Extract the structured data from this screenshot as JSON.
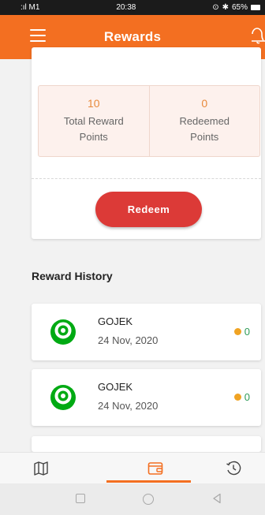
{
  "status_bar": {
    "carrier": ":ıl M1",
    "time": "20:38",
    "battery": "65%"
  },
  "app_bar": {
    "title": "Rewards",
    "menu_icon": "hamburger-menu-icon",
    "bell_icon": "bell-icon"
  },
  "summary": {
    "total": {
      "value": "10",
      "label": "Total Reward Points"
    },
    "redeemed": {
      "value": "0",
      "label": "Redeemed Points"
    },
    "redeem_button_label": "Redeem"
  },
  "history": {
    "title": "Reward History",
    "items": [
      {
        "merchant": "GOJEK",
        "date": "24 Nov, 2020",
        "points": "0"
      },
      {
        "merchant": "GOJEK",
        "date": "24 Nov, 2020",
        "points": "0"
      }
    ]
  },
  "bottom_nav": {
    "items": [
      {
        "icon": "map-icon",
        "active": false
      },
      {
        "icon": "wallet-icon",
        "active": true
      },
      {
        "icon": "history-clock-icon",
        "active": false
      }
    ]
  },
  "colors": {
    "primary": "#f36f21",
    "redeem_button": "#dc3a37",
    "gojek_green": "#00aa13",
    "coin": "#f0a323",
    "earned_points": "#2e9b57"
  }
}
